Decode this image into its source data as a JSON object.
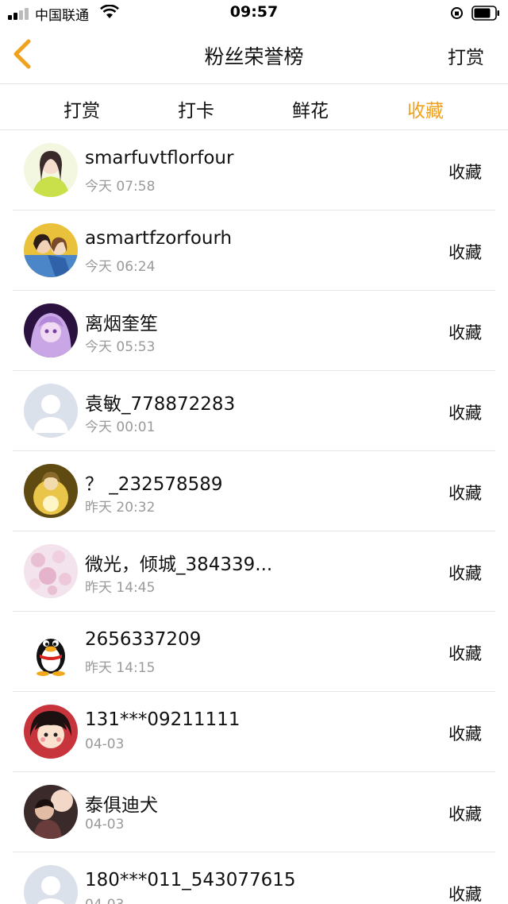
{
  "status_bar": {
    "carrier": "中国联通",
    "time": "09:57",
    "icons": [
      "signal-icon",
      "wifi-icon",
      "rotation-lock-icon",
      "battery-icon"
    ]
  },
  "header": {
    "title": "粉丝荣誉榜",
    "right_action": "打赏",
    "back_icon": "chevron-left-icon",
    "accent_color": "#f0a21f"
  },
  "tabs": [
    {
      "label": "打赏",
      "active": false
    },
    {
      "label": "打卡",
      "active": false
    },
    {
      "label": "鲜花",
      "active": false
    },
    {
      "label": "收藏",
      "active": true
    }
  ],
  "fans": [
    {
      "name": "smarfuvtflorfour",
      "time": "今天 07:58",
      "action": "收藏"
    },
    {
      "name": "asmartfzorfourh",
      "time": "今天 06:24",
      "action": "收藏"
    },
    {
      "name": "离烟奎笙",
      "time": "今天 05:53",
      "action": "收藏"
    },
    {
      "name": "袁敏_778872283",
      "time": "今天 00:01",
      "action": "收藏"
    },
    {
      "name": "？ _232578589",
      "time": "昨天 20:32",
      "action": "收藏"
    },
    {
      "name": "微光，倾城_384339...",
      "time": "昨天 14:45",
      "action": "收藏"
    },
    {
      "name": "2656337209",
      "time": "昨天 14:15",
      "action": "收藏"
    },
    {
      "name": "131***09211111",
      "time": "04-03",
      "action": "收藏"
    },
    {
      "name": "泰俱迪犬",
      "time": "04-03",
      "action": "收藏"
    },
    {
      "name": "180***011_543077615",
      "time": "04-03",
      "action": "收藏"
    }
  ]
}
